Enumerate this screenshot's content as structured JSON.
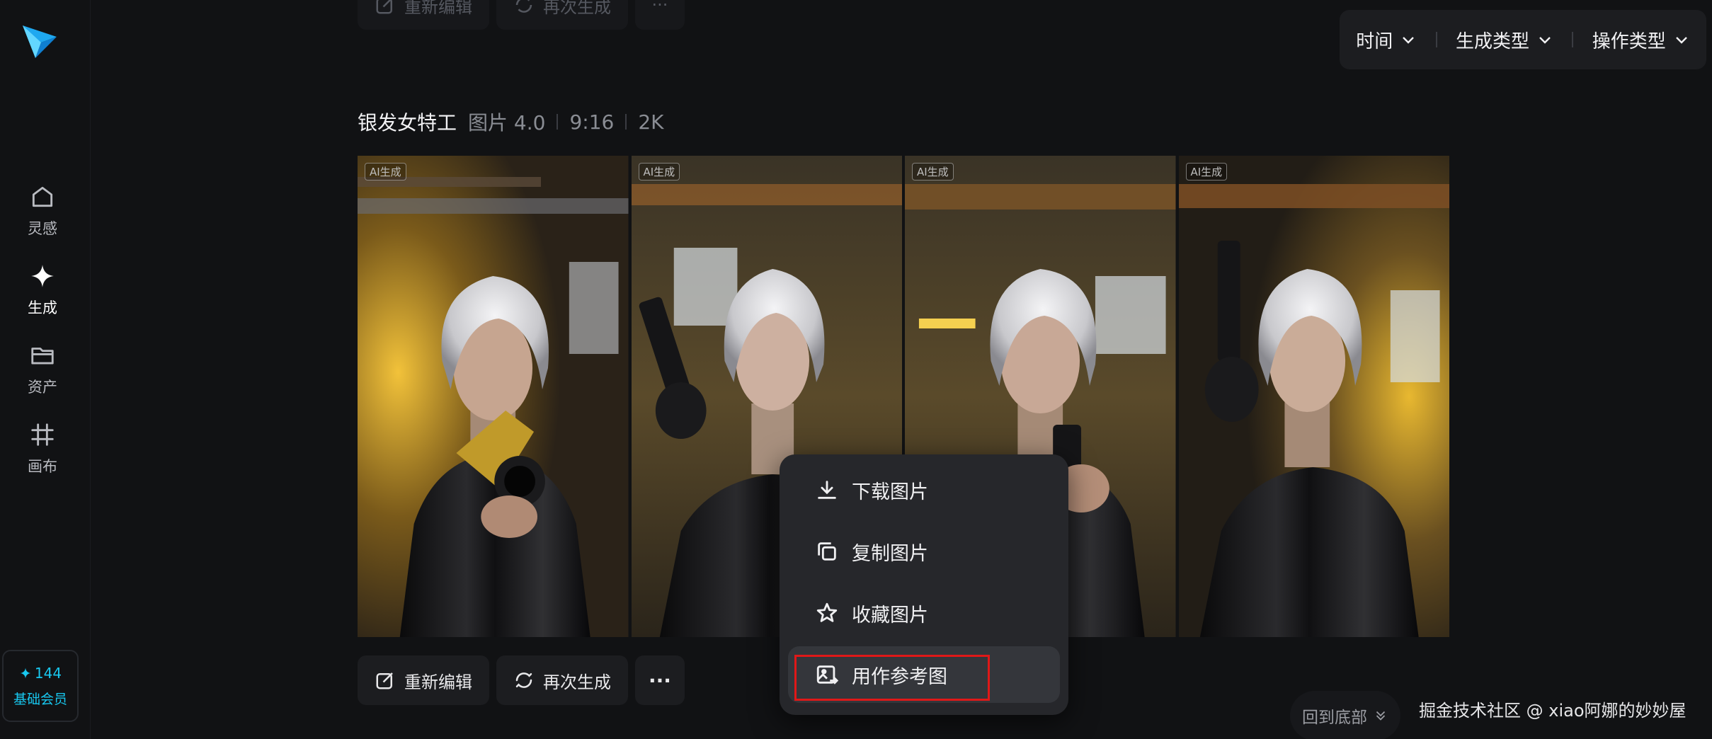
{
  "sidebar": {
    "items": [
      {
        "label": "灵感",
        "icon": "home-icon"
      },
      {
        "label": "生成",
        "icon": "sparkle-icon",
        "active": true
      },
      {
        "label": "资产",
        "icon": "folder-icon"
      },
      {
        "label": "画布",
        "icon": "canvas-icon"
      }
    ],
    "member": {
      "points": "144",
      "tier": "基础会员"
    }
  },
  "toolbar_top": {
    "edit_label": "重新编辑",
    "regenerate_label": "再次生成",
    "more": "···"
  },
  "filters": {
    "time": "时间",
    "gen_type": "生成类型",
    "op_type": "操作类型"
  },
  "generation": {
    "title": "银发女特工",
    "model": "图片 4.0",
    "ratio": "9:16",
    "resolution": "2K",
    "ai_tag": "AI生成"
  },
  "actions": {
    "edit_label": "重新编辑",
    "regenerate_label": "再次生成",
    "more": "···"
  },
  "context_menu": {
    "items": [
      {
        "label": "下载图片",
        "icon": "download-icon"
      },
      {
        "label": "复制图片",
        "icon": "copy-icon"
      },
      {
        "label": "收藏图片",
        "icon": "star-icon"
      },
      {
        "label": "用作参考图",
        "icon": "image-reference-icon"
      }
    ]
  },
  "footer": {
    "scroll_bottom": "回到底部",
    "watermark": "掘金技术社区 @ xiao阿娜的妙妙屋"
  },
  "colors": {
    "accent": "#18c8f0",
    "highlight": "#e01818",
    "background": "#111214"
  }
}
